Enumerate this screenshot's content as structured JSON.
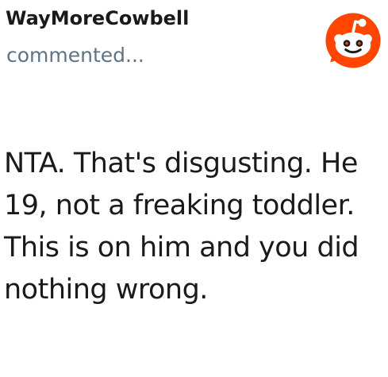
{
  "comment": {
    "author": "WayMoreCowbell",
    "action_text": "commented...",
    "body": "NTA. That's disgusting. He 19, not a freaking toddler. This is on him and you did nothing wrong."
  },
  "icons": {
    "logo": "reddit-snoo-logo"
  },
  "colors": {
    "brand_orange": "#FF4500",
    "text_dark": "#1A1A1B",
    "text_muted": "#5F7380"
  }
}
